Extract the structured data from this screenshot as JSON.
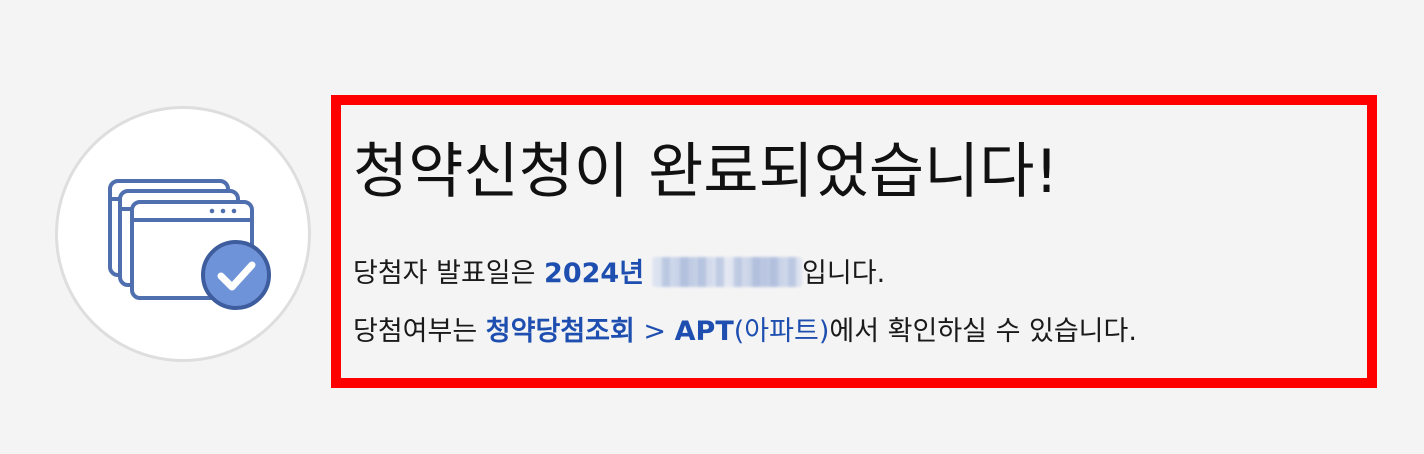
{
  "icon": "browser-windows-check-icon",
  "colors": {
    "highlight_border": "#ff0000",
    "link": "#1e4fb0",
    "icon_stroke": "#4f6fae",
    "icon_badge": "#6f93d8"
  },
  "title": "청약신청이 완료되었습니다!",
  "announcement": {
    "prefix": "당첨자 발표일은 ",
    "year": "2024년",
    "suffix": "입니다."
  },
  "result": {
    "prefix": "당첨여부는 ",
    "link_label": "청약당첨조회",
    "separator": " > ",
    "apt_label": "APT",
    "paren_open": "(",
    "apt_sub_label": "아파트",
    "paren_close": ")",
    "suffix": "에서 확인하실 수 있습니다."
  }
}
